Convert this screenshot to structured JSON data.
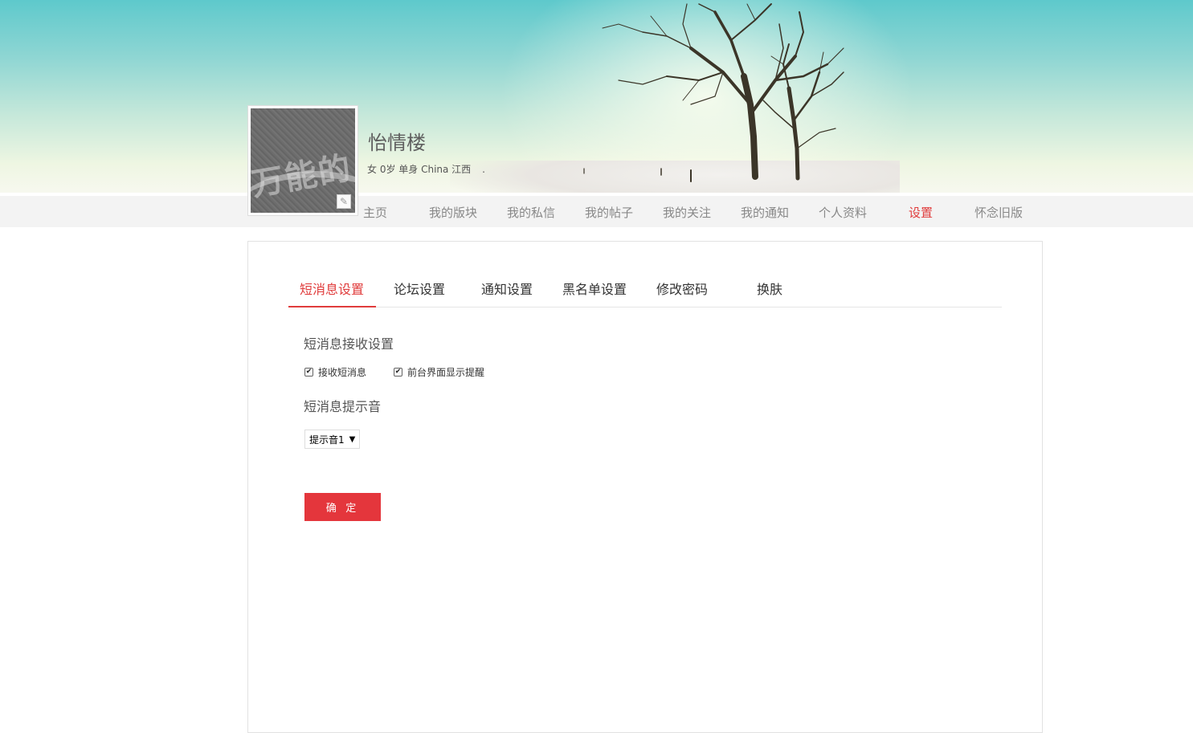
{
  "profile": {
    "name": "怡情楼",
    "info": "女 0岁 单身 China 江西",
    "info_suffix": "."
  },
  "nav": {
    "items": [
      "主页",
      "我的版块",
      "我的私信",
      "我的帖子",
      "我的关注",
      "我的通知",
      "个人资料",
      "设置",
      "怀念旧版"
    ],
    "active": "设置"
  },
  "settings": {
    "tabs": [
      "短消息设置",
      "论坛设置",
      "通知设置",
      "黑名单设置",
      "修改密码",
      "换肤"
    ],
    "active_tab": "短消息设置",
    "receive_title": "短消息接收设置",
    "options": [
      {
        "label": "接收短消息",
        "checked": true
      },
      {
        "label": "前台界面显示提醒",
        "checked": true
      }
    ],
    "sound_title": "短消息提示音",
    "sound_selected": "提示音1",
    "confirm_label": "确 定"
  },
  "colors": {
    "accent": "#e03c3c",
    "button": "#e4363c",
    "nav_bg": "#f3f3f3"
  },
  "icons": {
    "avatar_edit": "pencil-icon",
    "checkbox": "check-icon",
    "select_arrow": "triangle-down-icon"
  }
}
